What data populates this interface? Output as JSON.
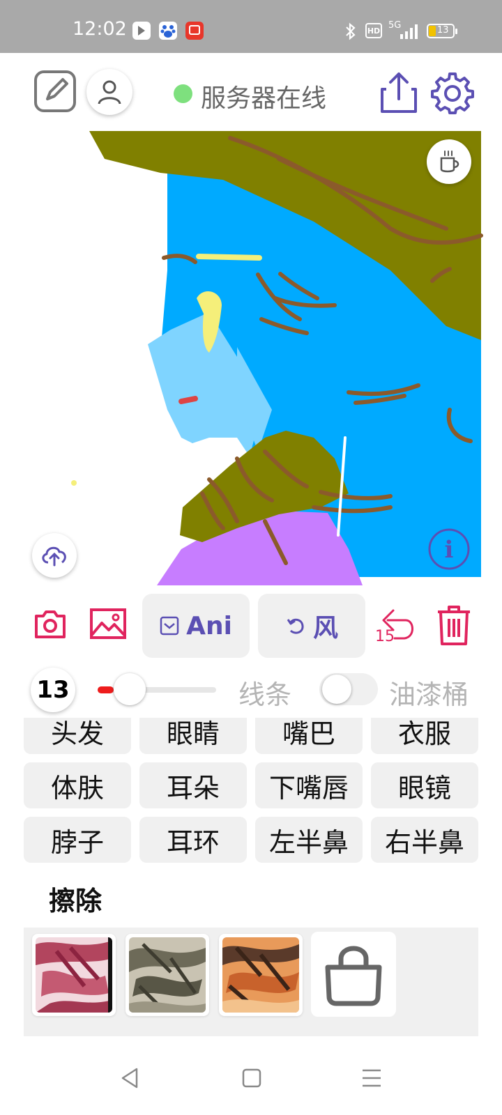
{
  "status_bar": {
    "time": "12:02",
    "network": "5G",
    "hd": "HD",
    "battery": "13"
  },
  "header": {
    "server_status": "服务器在线",
    "server_status_color": "#7ee07e",
    "icons": [
      "sketch-icon",
      "user-icon",
      "share-icon",
      "settings-icon"
    ]
  },
  "canvas": {
    "icons": [
      "coffee-icon",
      "cloud-upload-icon",
      "info-icon"
    ]
  },
  "toolbar": {
    "ani_label": "Ani",
    "style_label": "风",
    "undo_count": "15",
    "accent_color": "#e0245e",
    "purple_color": "#5b4fb3"
  },
  "brush": {
    "size": "13",
    "slider_level": 0.09,
    "slider_color": "#ee1c1c",
    "line_label": "线条",
    "bucket_label": "油漆桶",
    "bucket_enabled": false
  },
  "parts": [
    [
      "头发",
      "眼睛",
      "嘴巴",
      "衣服"
    ],
    [
      "体肤",
      "耳朵",
      "下嘴唇",
      "眼镜"
    ],
    [
      "脖子",
      "耳环",
      "左半鼻",
      "右半鼻"
    ]
  ],
  "erase_label": "擦除",
  "styles": {
    "cards": [
      "style-1",
      "style-2",
      "style-3"
    ],
    "shop_icon": "shopping-bag-icon"
  },
  "nav": [
    "back-icon",
    "home-icon",
    "menu-icon"
  ]
}
